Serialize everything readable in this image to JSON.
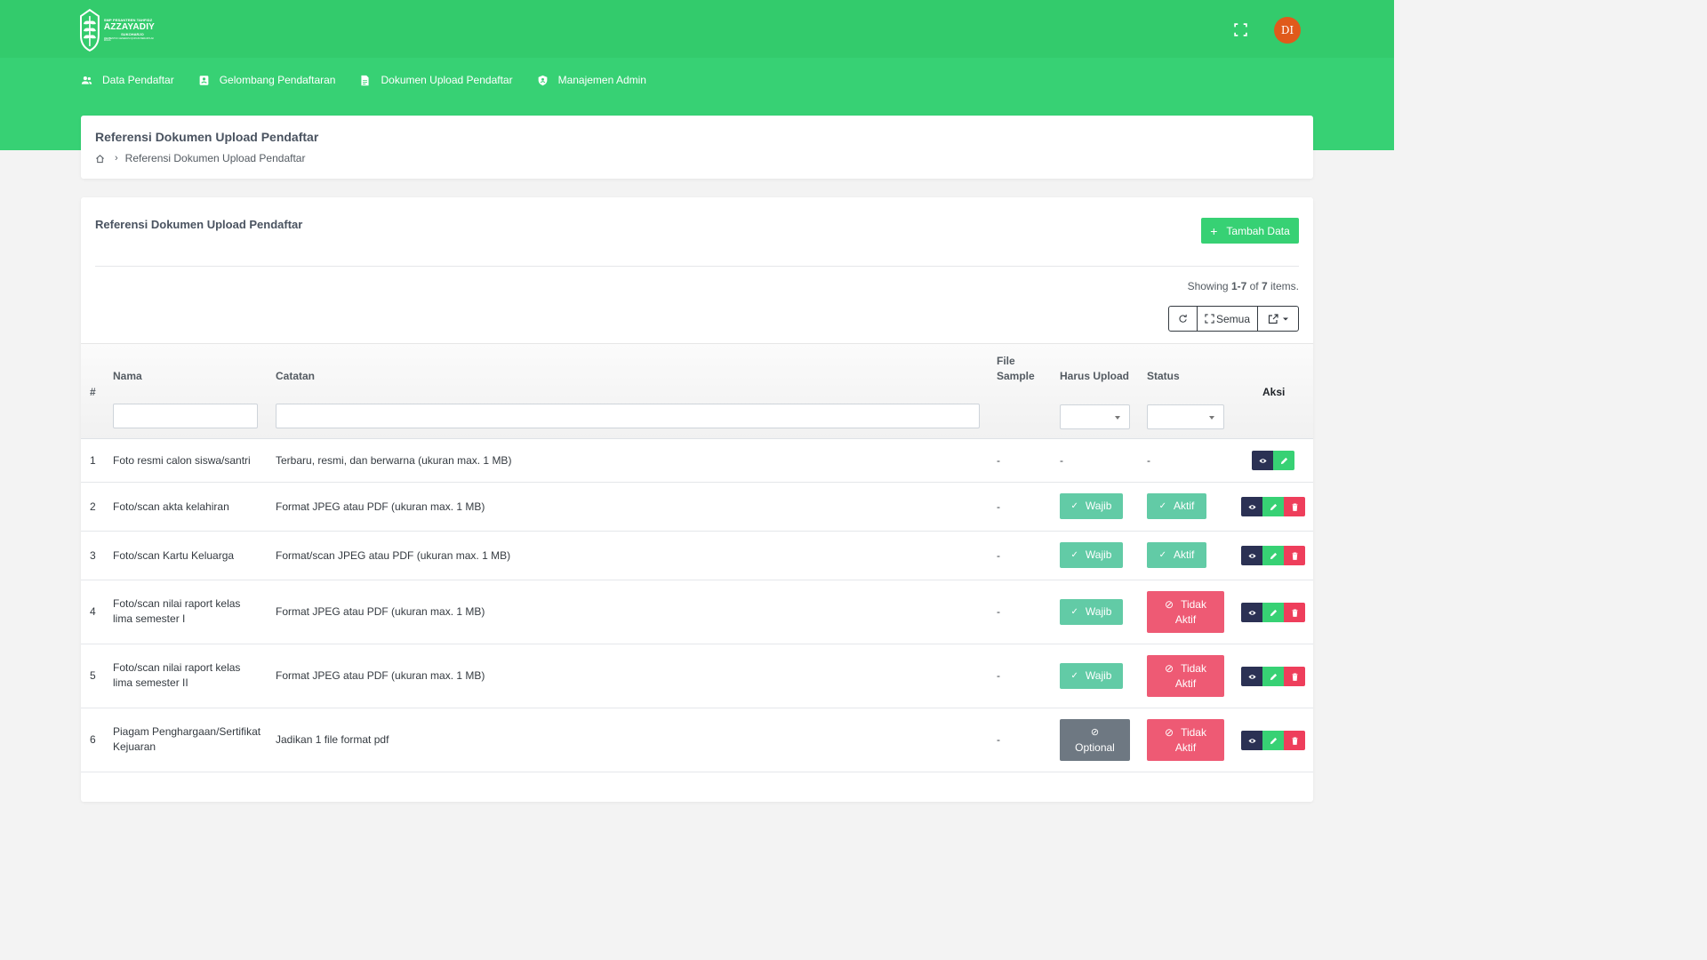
{
  "brand": {
    "line1": "SMP PESANTREN TAHFIDZ",
    "line2": "AZZAYADIY",
    "line3": "SUKOHARJO",
    "line4": "MEMBENTUK GENERASI QUR'ANI BERAKHLAK MULIA",
    "primary_color": "#37d174",
    "header_color": "#33cb6c"
  },
  "header": {
    "avatar_initials": "DI",
    "avatar_color": "#e05a1b"
  },
  "nav": {
    "items": [
      {
        "label": "Data Pendaftar",
        "icon": "users-icon"
      },
      {
        "label": "Gelombang Pendaftaran",
        "icon": "contact-card-icon"
      },
      {
        "label": "Dokumen Upload Pendaftar",
        "icon": "file-icon"
      },
      {
        "label": "Manajemen Admin",
        "icon": "shield-icon"
      }
    ]
  },
  "page": {
    "title": "Referensi Dokumen Upload Pendaftar",
    "breadcrumb_current": "Referensi Dokumen Upload Pendaftar"
  },
  "panel": {
    "title": "Referensi Dokumen Upload Pendaftar",
    "add_button": "Tambah Data",
    "summary_prefix": "Showing ",
    "summary_range": "1-7",
    "summary_mid": " of ",
    "summary_total": "7",
    "summary_suffix": " items.",
    "toolbar": {
      "all_label": "Semua"
    }
  },
  "table": {
    "columns": {
      "no": "#",
      "nama": "Nama",
      "catatan": "Catatan",
      "file_sample_1": "File",
      "file_sample_2": "Sample",
      "harus_upload": "Harus Upload",
      "status": "Status",
      "aksi": "Aksi"
    },
    "rows": [
      {
        "no": "1",
        "nama": "Foto resmi calon siswa/santri",
        "catatan": "Terbaru, resmi, dan berwarna (ukuran max. 1 MB)",
        "file_sample": "-",
        "harus_upload": "-",
        "status": "-"
      },
      {
        "no": "2",
        "nama": "Foto/scan akta kelahiran",
        "catatan": "Format JPEG atau PDF (ukuran max. 1 MB)",
        "file_sample": "-",
        "harus_upload": "Wajib",
        "status": "Aktif"
      },
      {
        "no": "3",
        "nama": "Foto/scan Kartu Keluarga",
        "catatan": "Format/scan JPEG atau PDF (ukuran max. 1 MB)",
        "file_sample": "-",
        "harus_upload": "Wajib",
        "status": "Aktif"
      },
      {
        "no": "4",
        "nama_1": "Foto/scan nilai raport kelas",
        "nama_2": "lima semester I",
        "catatan": "Format JPEG atau PDF (ukuran max. 1 MB)",
        "file_sample": "-",
        "harus_upload": "Wajib",
        "status_1": "Tidak",
        "status_2": "Aktif"
      },
      {
        "no": "5",
        "nama_1": "Foto/scan nilai raport kelas",
        "nama_2": "lima semester II",
        "catatan": "Format JPEG atau PDF (ukuran max. 1 MB)",
        "file_sample": "-",
        "harus_upload": "Wajib",
        "status_1": "Tidak",
        "status_2": "Aktif"
      },
      {
        "no": "6",
        "nama_1": "Piagam Penghargaan/Sertifikat",
        "nama_2": "Kejuaran",
        "catatan": "Jadikan 1 file format pdf",
        "file_sample": "-",
        "harus_upload": "Optional",
        "status_1": "Tidak",
        "status_2": "Aktif"
      }
    ]
  }
}
